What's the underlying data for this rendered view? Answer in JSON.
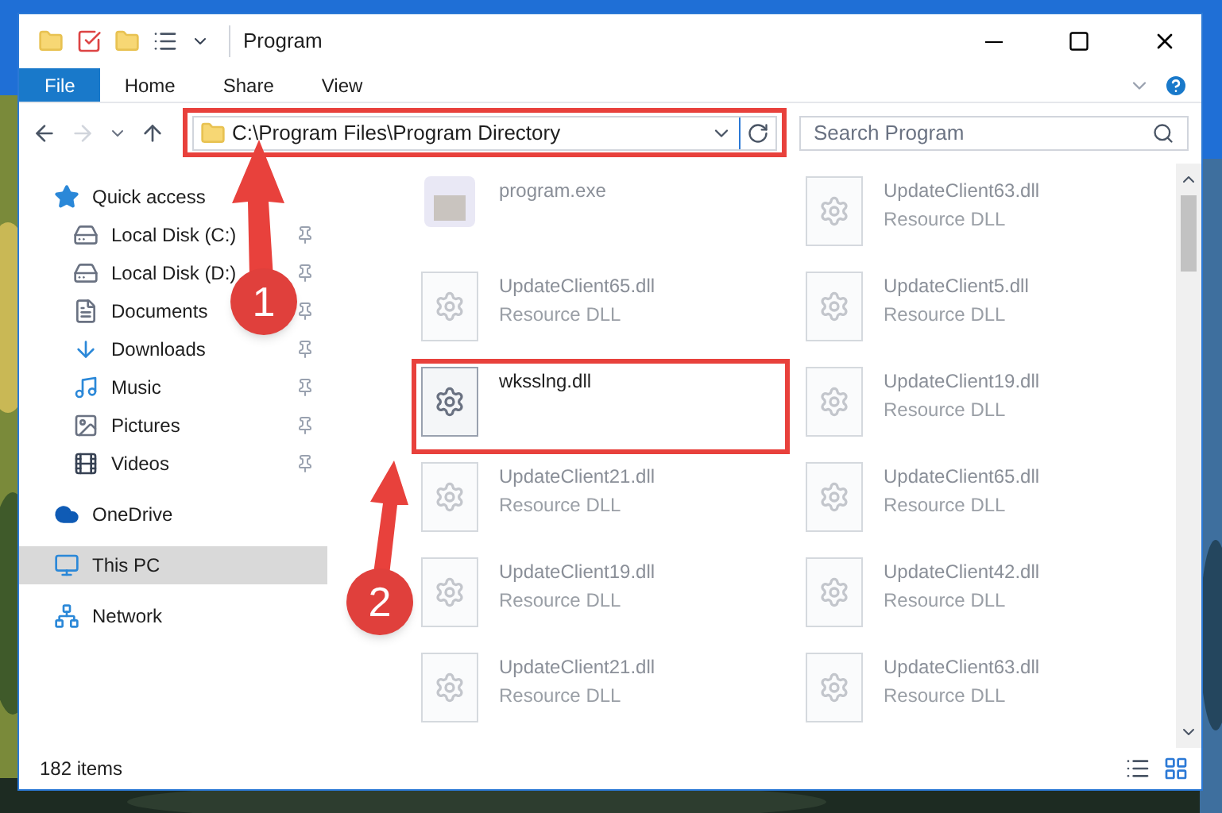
{
  "window": {
    "title": "Program"
  },
  "ribbon": {
    "tabs": [
      {
        "label": "File",
        "kind": "file"
      },
      {
        "label": "Home",
        "kind": "tab"
      },
      {
        "label": "Share",
        "kind": "tab"
      },
      {
        "label": "View",
        "kind": "tab"
      }
    ]
  },
  "address": {
    "path": "C:\\Program Files\\Program Directory"
  },
  "search": {
    "placeholder": "Search Program"
  },
  "sidebar": {
    "items": [
      {
        "label": "Quick access",
        "kind": "star",
        "selected": false,
        "children": [
          {
            "label": "Local Disk (C:)",
            "kind": "disk",
            "pinned": true
          },
          {
            "label": "Local Disk (D:)",
            "kind": "disk",
            "pinned": true
          },
          {
            "label": "Documents",
            "kind": "document",
            "pinned": true
          },
          {
            "label": "Downloads",
            "kind": "download",
            "pinned": true
          },
          {
            "label": "Music",
            "kind": "music",
            "pinned": true
          },
          {
            "label": "Pictures",
            "kind": "pictures",
            "pinned": true
          },
          {
            "label": "Videos",
            "kind": "videos",
            "pinned": true
          }
        ]
      },
      {
        "label": "OneDrive",
        "kind": "cloud",
        "selected": false
      },
      {
        "label": "This PC",
        "kind": "pc",
        "selected": true
      },
      {
        "label": "Network",
        "kind": "network",
        "selected": false
      }
    ]
  },
  "files": [
    {
      "name": "program.exe",
      "kind": "exe",
      "faded": true
    },
    {
      "name": "UpdateClient63.dll",
      "type": "Resource DLL",
      "kind": "dll",
      "faded": true
    },
    {
      "name": "UpdateClient65.dll",
      "type": "Resource DLL",
      "kind": "dll",
      "faded": true
    },
    {
      "name": "UpdateClient5.dll",
      "type": "Resource DLL",
      "kind": "dll",
      "faded": true
    },
    {
      "name": "wksslng.dll",
      "kind": "dll",
      "faded": false
    },
    {
      "name": "UpdateClient19.dll",
      "type": "Resource DLL",
      "kind": "dll",
      "faded": true
    },
    {
      "name": "UpdateClient21.dll",
      "type": "Resource DLL",
      "kind": "dll",
      "faded": true
    },
    {
      "name": "UpdateClient65.dll",
      "type": "Resource DLL",
      "kind": "dll",
      "faded": true
    },
    {
      "name": "UpdateClient19.dll",
      "type": "Resource DLL",
      "kind": "dll",
      "faded": true
    },
    {
      "name": "UpdateClient42.dll",
      "type": "Resource DLL",
      "kind": "dll",
      "faded": true
    },
    {
      "name": "UpdateClient21.dll",
      "type": "Resource DLL",
      "kind": "dll",
      "faded": true
    },
    {
      "name": "UpdateClient63.dll",
      "type": "Resource DLL",
      "kind": "dll",
      "faded": true
    }
  ],
  "status_bar": {
    "item_count": "182 items"
  },
  "annotations": [
    {
      "label": "1"
    },
    {
      "label": "2"
    }
  ]
}
